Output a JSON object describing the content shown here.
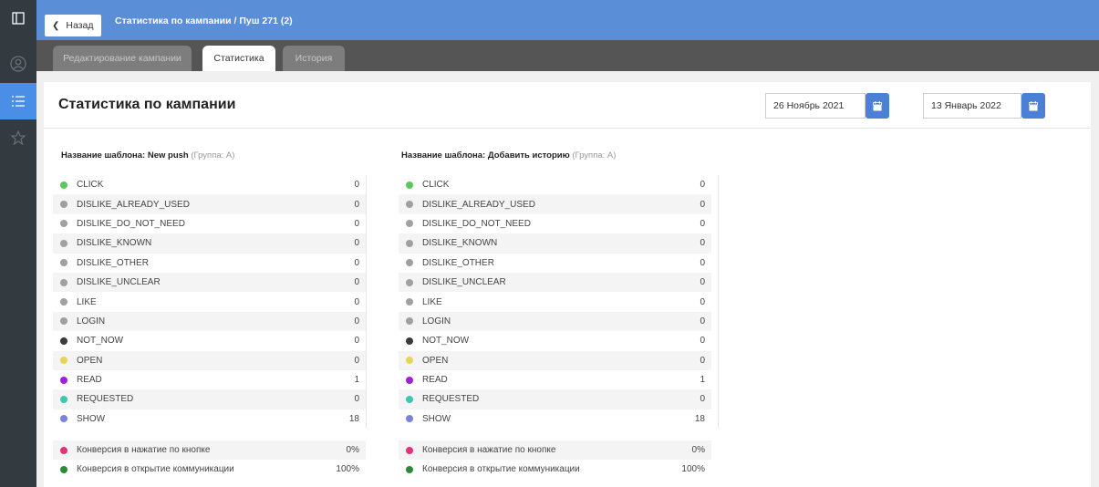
{
  "header": {
    "back_label": "Назад",
    "breadcrumb": "Статистика по кампании / Пуш 271 (2)"
  },
  "tabs": [
    {
      "label": "Редактирование кампании",
      "active": false
    },
    {
      "label": "Статистика",
      "active": true
    },
    {
      "label": "История",
      "active": false
    }
  ],
  "page": {
    "title": "Статистика по кампании",
    "date_from": "26 Ноябрь 2021",
    "date_to": "13 Январь 2022"
  },
  "templates": [
    {
      "label": "Название шаблона: New push",
      "group": "(Группа: A)",
      "rows": [
        {
          "name": "CLICK",
          "value": "0",
          "color": "#5cc85c"
        },
        {
          "name": "DISLIKE_ALREADY_USED",
          "value": "0",
          "color": "#a0a0a0"
        },
        {
          "name": "DISLIKE_DO_NOT_NEED",
          "value": "0",
          "color": "#a0a0a0"
        },
        {
          "name": "DISLIKE_KNOWN",
          "value": "0",
          "color": "#a0a0a0"
        },
        {
          "name": "DISLIKE_OTHER",
          "value": "0",
          "color": "#a0a0a0"
        },
        {
          "name": "DISLIKE_UNCLEAR",
          "value": "0",
          "color": "#a0a0a0"
        },
        {
          "name": "LIKE",
          "value": "0",
          "color": "#a0a0a0"
        },
        {
          "name": "LOGIN",
          "value": "0",
          "color": "#a0a0a0"
        },
        {
          "name": "NOT_NOW",
          "value": "0",
          "color": "#3a3a3a"
        },
        {
          "name": "OPEN",
          "value": "0",
          "color": "#e8d35a"
        },
        {
          "name": "READ",
          "value": "1",
          "color": "#a020e0"
        },
        {
          "name": "REQUESTED",
          "value": "0",
          "color": "#3cc8b0"
        },
        {
          "name": "SHOW",
          "value": "18",
          "color": "#7a82e0"
        }
      ],
      "conversions": [
        {
          "name": "Конверсия в нажатие по кнопке",
          "value": "0%",
          "color": "#e8307a"
        },
        {
          "name": "Конверсия в открытие коммуникации",
          "value": "100%",
          "color": "#2a8a3a"
        }
      ]
    },
    {
      "label": "Название шаблона: Добавить историю",
      "group": "(Группа: A)",
      "rows": [
        {
          "name": "CLICK",
          "value": "0",
          "color": "#5cc85c"
        },
        {
          "name": "DISLIKE_ALREADY_USED",
          "value": "0",
          "color": "#a0a0a0"
        },
        {
          "name": "DISLIKE_DO_NOT_NEED",
          "value": "0",
          "color": "#a0a0a0"
        },
        {
          "name": "DISLIKE_KNOWN",
          "value": "0",
          "color": "#a0a0a0"
        },
        {
          "name": "DISLIKE_OTHER",
          "value": "0",
          "color": "#a0a0a0"
        },
        {
          "name": "DISLIKE_UNCLEAR",
          "value": "0",
          "color": "#a0a0a0"
        },
        {
          "name": "LIKE",
          "value": "0",
          "color": "#a0a0a0"
        },
        {
          "name": "LOGIN",
          "value": "0",
          "color": "#a0a0a0"
        },
        {
          "name": "NOT_NOW",
          "value": "0",
          "color": "#3a3a3a"
        },
        {
          "name": "OPEN",
          "value": "0",
          "color": "#e8d35a"
        },
        {
          "name": "READ",
          "value": "1",
          "color": "#a020e0"
        },
        {
          "name": "REQUESTED",
          "value": "0",
          "color": "#3cc8b0"
        },
        {
          "name": "SHOW",
          "value": "18",
          "color": "#7a82e0"
        }
      ],
      "conversions": [
        {
          "name": "Конверсия в нажатие по кнопке",
          "value": "0%",
          "color": "#e8307a"
        },
        {
          "name": "Конверсия в открытие коммуникации",
          "value": "100%",
          "color": "#2a8a3a"
        }
      ]
    }
  ]
}
